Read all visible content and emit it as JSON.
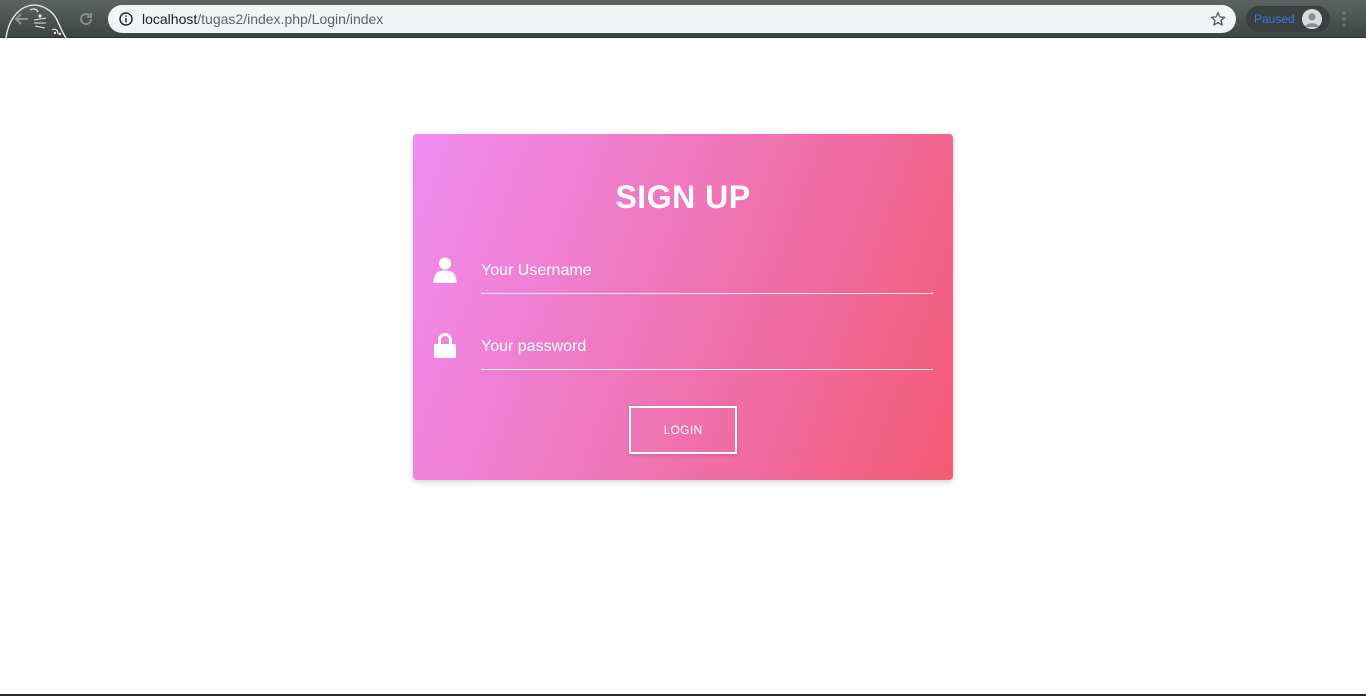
{
  "browser": {
    "url_host": "localhost",
    "url_path": "/tugas2/index.php/Login/index",
    "profile_status": "Paused",
    "icons": {
      "back": "back-arrow-icon",
      "reload": "reload-icon",
      "info": "info-icon",
      "bookmark": "star-icon",
      "avatar": "avatar-icon",
      "menu": "kebab-menu-icon"
    }
  },
  "login_card": {
    "title": "SIGN UP",
    "username_placeholder": "Your Username",
    "password_placeholder": "Your password",
    "login_label": "LOGIN",
    "icons": {
      "username": "user-icon",
      "password": "lock-icon"
    },
    "colors": {
      "gradient_start": "#f08cf2",
      "gradient_end": "#f45a72",
      "text": "#ffffff"
    }
  }
}
